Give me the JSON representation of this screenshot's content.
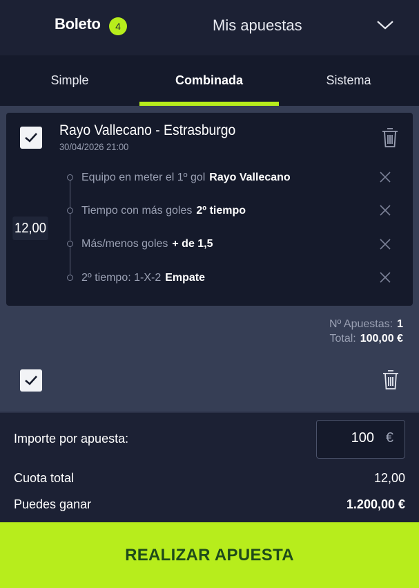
{
  "header": {
    "boleto_label": "Boleto",
    "badge_count": "4",
    "mis_apuestas_label": "Mis apuestas"
  },
  "tabs": [
    {
      "label": "Simple",
      "active": false
    },
    {
      "label": "Combinada",
      "active": true
    },
    {
      "label": "Sistema",
      "active": false
    }
  ],
  "bet": {
    "match": "Rayo Vallecano - Estrasburgo",
    "datetime": "30/04/2026 21:00",
    "odds": "12,00",
    "selections": [
      {
        "market": "Equipo en meter el 1º gol",
        "pick": "Rayo Vallecano"
      },
      {
        "market": "Tiempo con más goles",
        "pick": "2º tiempo"
      },
      {
        "market": "Más/menos goles",
        "pick": "+ de 1,5"
      },
      {
        "market": "2º tiempo: 1-X-2",
        "pick": "Empate"
      }
    ]
  },
  "summary": {
    "num_bets_label": "Nº Apuestas:",
    "num_bets_value": "1",
    "total_label": "Total:",
    "total_value": "100,00 €"
  },
  "stake": {
    "label": "Importe por apuesta:",
    "value": "100",
    "currency": "€"
  },
  "totals": {
    "odds_label": "Cuota total",
    "odds_value": "12,00",
    "win_label": "Puedes ganar",
    "win_value": "1.200,00 €"
  },
  "cta": {
    "label": "REALIZAR APUESTA"
  },
  "colors": {
    "accent": "#b7ed1c",
    "background": "#363e55",
    "header": "#1c2134",
    "card": "#151a2b"
  }
}
